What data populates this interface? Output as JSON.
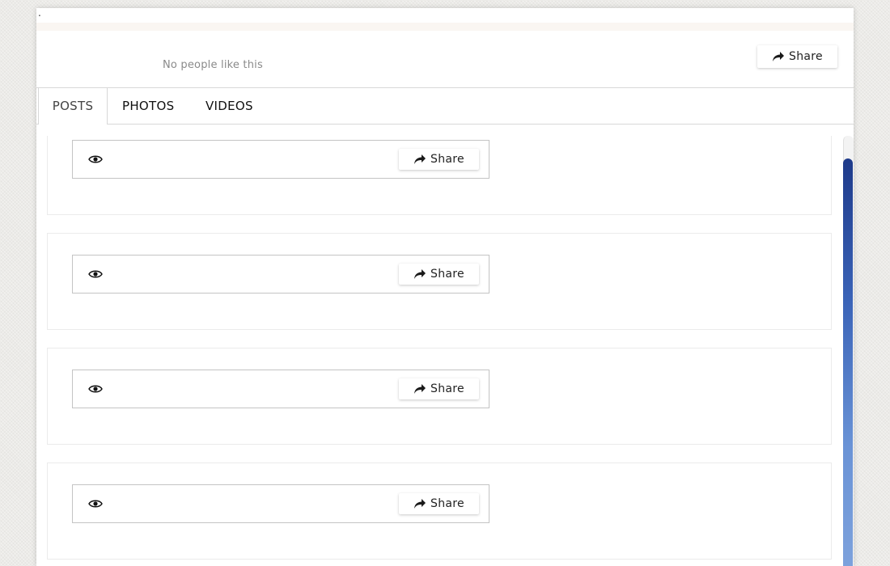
{
  "page": {
    "top_dot": ".",
    "likes_text": "No people like this",
    "header_share_label": "Share"
  },
  "tabs": [
    {
      "label": "POSTS",
      "active": true
    },
    {
      "label": "PHOTOS",
      "active": false
    },
    {
      "label": "VIDEOS",
      "active": false
    }
  ],
  "posts": [
    {
      "icon": "eye-icon",
      "share_label": "Share"
    },
    {
      "icon": "eye-icon",
      "share_label": "Share"
    },
    {
      "icon": "eye-icon",
      "share_label": "Share"
    },
    {
      "icon": "eye-icon",
      "share_label": "Share"
    }
  ],
  "colors": {
    "scrollbar_top": "#1e3a8a",
    "scrollbar_bottom": "#7ea2dc",
    "muted_text": "#8a8a8a"
  }
}
